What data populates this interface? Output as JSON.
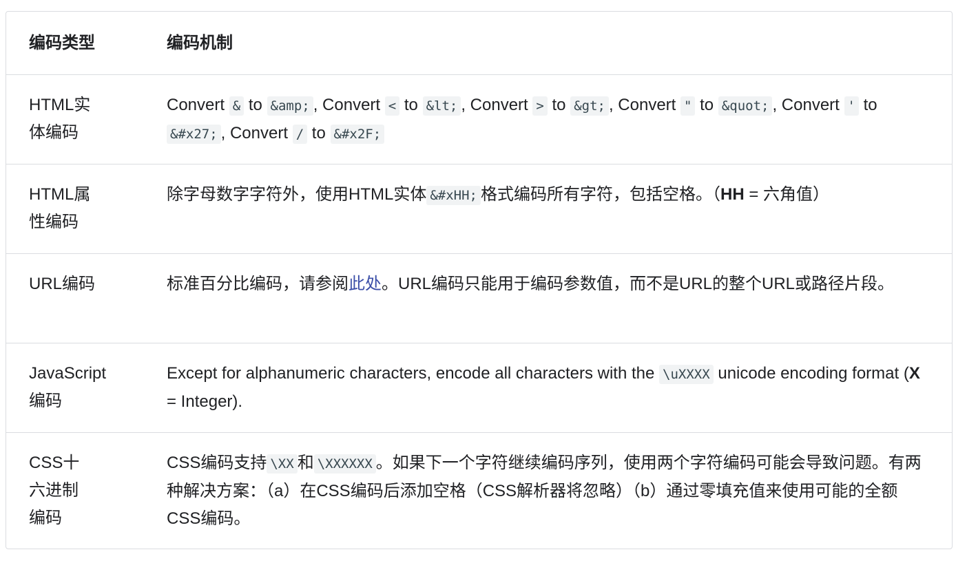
{
  "table": {
    "headers": [
      "编码类型",
      "编码机制"
    ],
    "rows": [
      {
        "type": "HTML实体编码",
        "mechanism": {
          "parts": [
            "Convert ",
            "&",
            " to ",
            "&amp;",
            ", Convert ",
            "<",
            " to ",
            "&lt;",
            ", Convert ",
            ">",
            " to ",
            "&gt;",
            ", Convert ",
            "\"",
            " to ",
            "&quot;",
            ", Convert ",
            "'",
            " to ",
            "&#x27;",
            ", Convert ",
            "/",
            " to ",
            "&#x2F;"
          ]
        }
      },
      {
        "type": "HTML属性编码",
        "mechanism": {
          "prefix": "除字母数字字符外，使用HTML实体",
          "code": "&#xHH;",
          "suffix": "格式编码所有字符，包括空格。（",
          "bold": "HH",
          "tail": " = 六角值）"
        }
      },
      {
        "type": "URL编码",
        "mechanism": {
          "prefix": "标准百分比编码，请参阅",
          "link": "此处",
          "suffix": "。URL编码只能用于编码参数值，而不是URL的整个URL或路径片段。"
        }
      },
      {
        "type": "JavaScript编码",
        "mechanism": {
          "prefix": "Except for alphanumeric characters, encode all characters with the ",
          "code": "\\uXXXX",
          "suffix": " unicode encoding format (",
          "bold": "X",
          "tail": " = Integer)."
        }
      },
      {
        "type": "CSS十六进制编码",
        "mechanism": {
          "prefix": "CSS编码支持",
          "code1": "\\XX",
          "middle": "和",
          "code2": "\\XXXXXX",
          "suffix": "。如果下一个字符继续编码序列，使用两个字符编码可能会导致问题。有两种解决方案：（a）在CSS编码后添加空格（CSS解析器将忽略）（b）通过零填充值来使用可能的全额CSS编码。"
        }
      }
    ]
  },
  "colors": {
    "border": "#dadce0",
    "link": "#3c4fa8",
    "code_bg": "#f1f3f4"
  }
}
